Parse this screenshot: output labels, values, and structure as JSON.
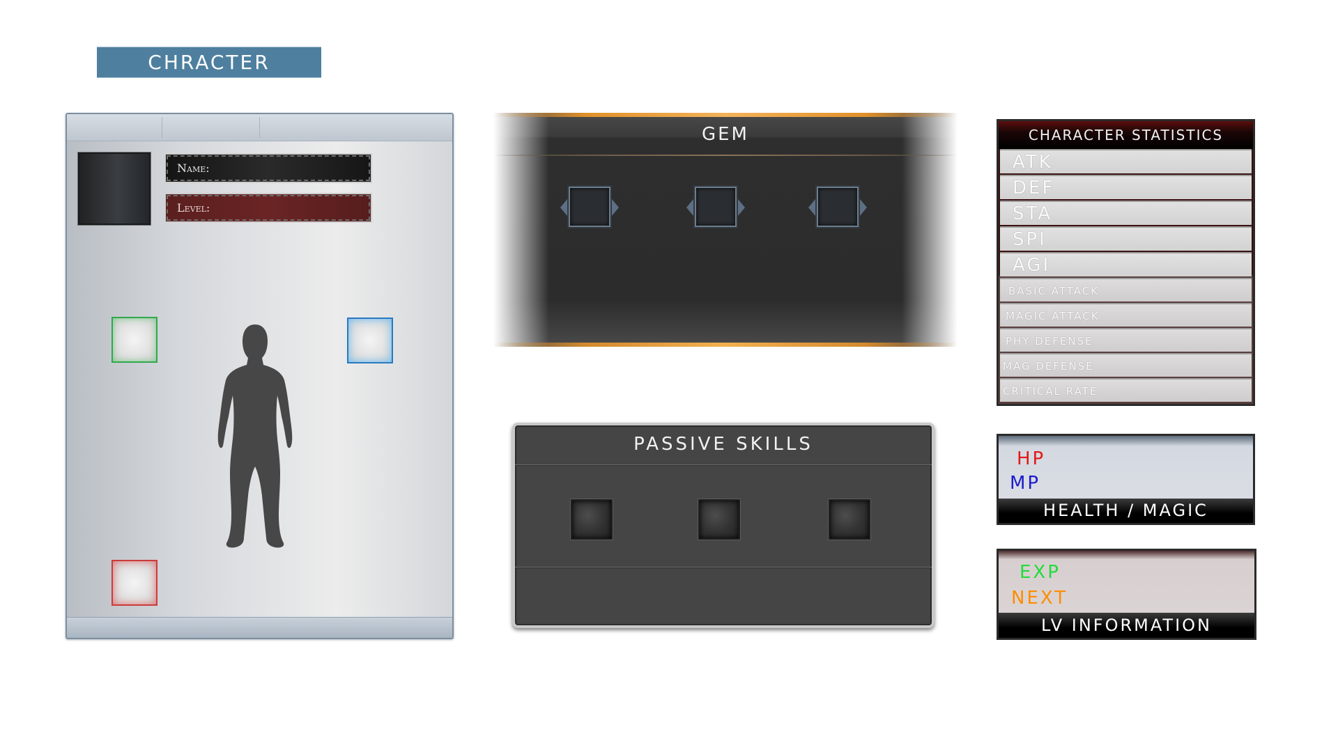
{
  "title_tab": {
    "label": "CHRACTER"
  },
  "character": {
    "name_label": "Name:",
    "level_label": "Level:"
  },
  "gem": {
    "title": "GEM"
  },
  "passive": {
    "title": "PASSIVE SKILLS"
  },
  "stats": {
    "header": "CHARACTER STATISTICS",
    "primary": [
      "ATK",
      "DEF",
      "STA",
      "SPI",
      "AGI"
    ],
    "secondary": [
      "BASIC ATTACK",
      "MAGIC ATTACK",
      "PHY  DEFENSE",
      "MAG  DEFENSE",
      "CRITICAL RATE"
    ]
  },
  "health_magic": {
    "hp": "HP",
    "mp": "MP",
    "footer": "HEALTH / MAGIC",
    "colors": {
      "hp": "#e21818",
      "mp": "#1b1bcc"
    }
  },
  "level_info": {
    "exp": "EXP",
    "next": "NEXT",
    "footer": "LV INFORMATION",
    "colors": {
      "exp": "#1fdc3a",
      "next": "#ff8c00"
    }
  },
  "colors": {
    "title_tab_bg": "#4e7f9f",
    "slot_green": "#2fa84a",
    "slot_blue": "#2a78c0",
    "slot_red": "#cc3a3a",
    "gem_glow": "#e0902a"
  }
}
